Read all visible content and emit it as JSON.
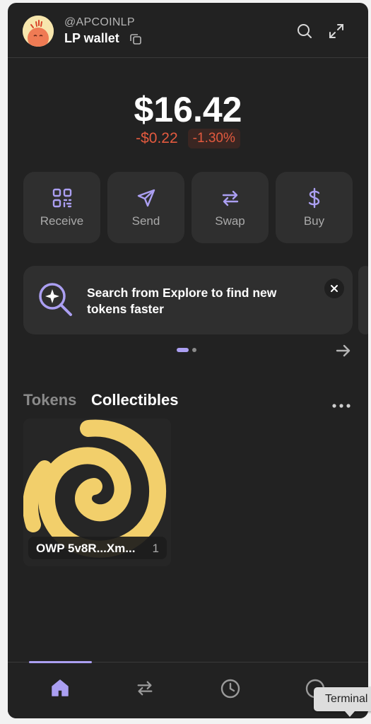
{
  "header": {
    "handle": "@APCOINLP",
    "wallet_name": "LP wallet",
    "icons": [
      "avatar",
      "copy-icon",
      "search-icon",
      "expand-icon"
    ]
  },
  "balance": {
    "total": "$16.42",
    "change_abs": "-$0.22",
    "change_pct": "-1.30%"
  },
  "actions": [
    {
      "label": "Receive",
      "icon": "qr-code-icon"
    },
    {
      "label": "Send",
      "icon": "send-icon"
    },
    {
      "label": "Swap",
      "icon": "swap-icon"
    },
    {
      "label": "Buy",
      "icon": "dollar-icon"
    }
  ],
  "banner": {
    "text": "Search from Explore to find new tokens faster",
    "icon": "sparkle-search-icon"
  },
  "tabs": {
    "tokens": "Tokens",
    "collectibles": "Collectibles"
  },
  "collectibles": [
    {
      "name": "OWP 5v8R...Xm...",
      "count": "1"
    }
  ],
  "bottom_nav": [
    "home-icon",
    "swap-icon",
    "history-icon",
    "explore-icon"
  ],
  "tooltip": {
    "text": "Terminal"
  },
  "colors": {
    "background": "#222222",
    "card": "#2f2f2f",
    "accent": "#ab9ff2",
    "negative": "#e35a3f",
    "collectible_gold": "#f2cf6b"
  }
}
